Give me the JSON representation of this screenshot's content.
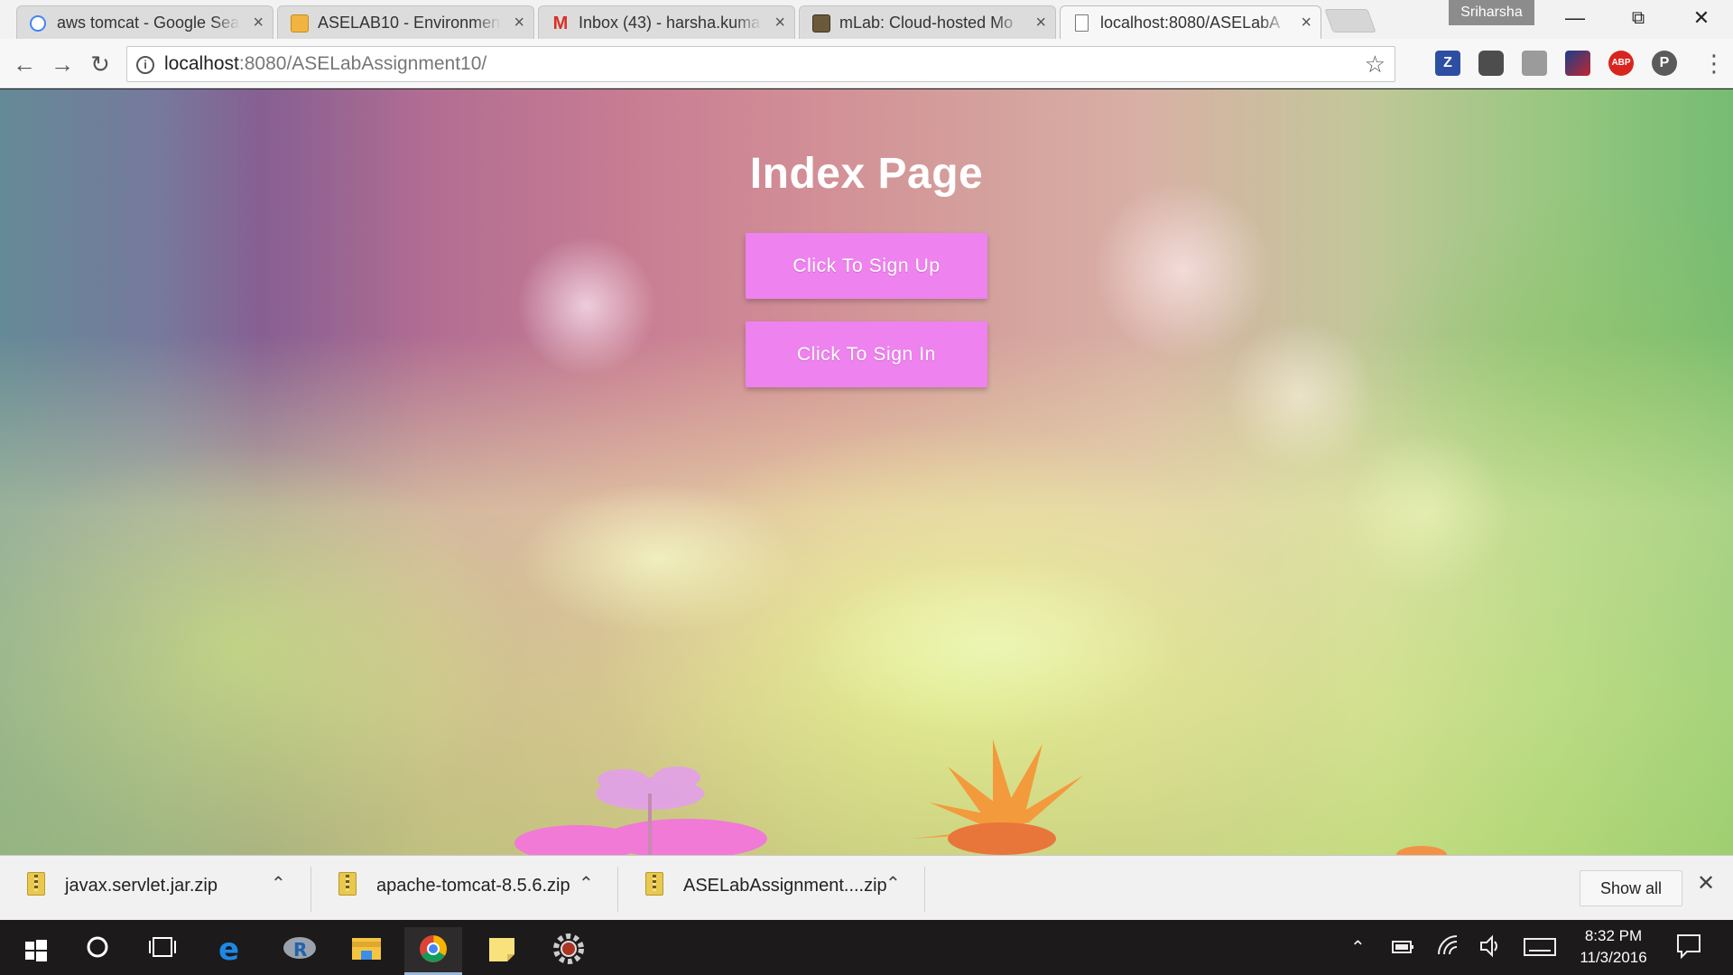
{
  "browser": {
    "tabs": [
      {
        "label": "aws tomcat - Google Sea",
        "icon": "google-icon"
      },
      {
        "label": "ASELAB10 - Environment",
        "icon": "aws-box-icon"
      },
      {
        "label": "Inbox (43) - harsha.kuma",
        "icon": "gmail-icon"
      },
      {
        "label": "mLab: Cloud-hosted Mo",
        "icon": "mlab-icon"
      },
      {
        "label": "localhost:8080/ASELabA",
        "icon": "page-icon"
      }
    ],
    "profile_name": "Sriharsha",
    "address": {
      "host": "localhost",
      "rest": ":8080/ASELabAssignment10/"
    },
    "extensions": [
      "zotero-icon",
      "keeper-icon",
      "camera-icon",
      "extension-icon",
      "adblock-plus-icon",
      "pushbullet-icon"
    ],
    "extension_labels": {
      "zotero": "Z",
      "abp": "ABP",
      "p": "P"
    }
  },
  "page": {
    "title": "Index Page",
    "signup_label": "Click To Sign Up",
    "signin_label": "Click To Sign In",
    "button_color": "#ee82ee"
  },
  "downloads": {
    "items": [
      {
        "name": "javax.servlet.jar.zip"
      },
      {
        "name": "apache-tomcat-8.5.6.zip"
      },
      {
        "name": "ASELabAssignment....zip"
      }
    ],
    "show_all_label": "Show all"
  },
  "taskbar": {
    "time": "8:32 PM",
    "date": "11/3/2016"
  }
}
